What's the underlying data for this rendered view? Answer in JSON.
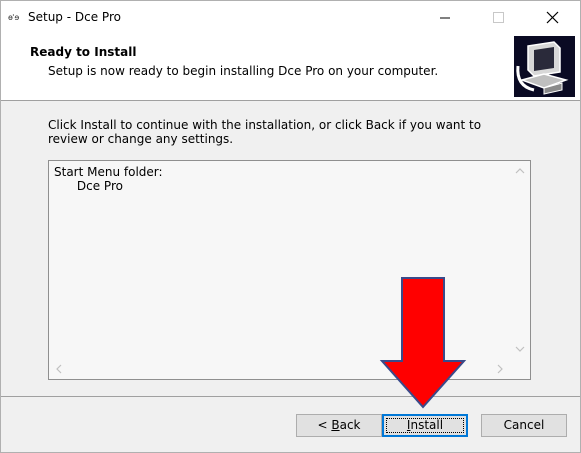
{
  "window": {
    "title": "Setup - Dce Pro",
    "icon": "setup-app-icon",
    "icon_text": "ɵʿɘ"
  },
  "titlebar_buttons": {
    "minimize": "—",
    "maximize": "☐",
    "close": "✕"
  },
  "header": {
    "title": "Ready to Install",
    "subtitle": "Setup is now ready to begin installing Dce Pro on your computer.",
    "logo": "installer-computer-logo"
  },
  "main": {
    "instructions": "Click Install to continue with the installation, or click Back if you want to review or change any settings.",
    "memo_lines": "Start Menu folder:\n      Dce Pro"
  },
  "buttons": {
    "back_prefix": "< ",
    "back_access": "B",
    "back_rest": "ack",
    "install_access": "I",
    "install_rest": "nstall",
    "cancel": "Cancel"
  },
  "annotation": {
    "type": "red-down-arrow",
    "color": "#ff0000",
    "outline": "#3a4a8a"
  }
}
